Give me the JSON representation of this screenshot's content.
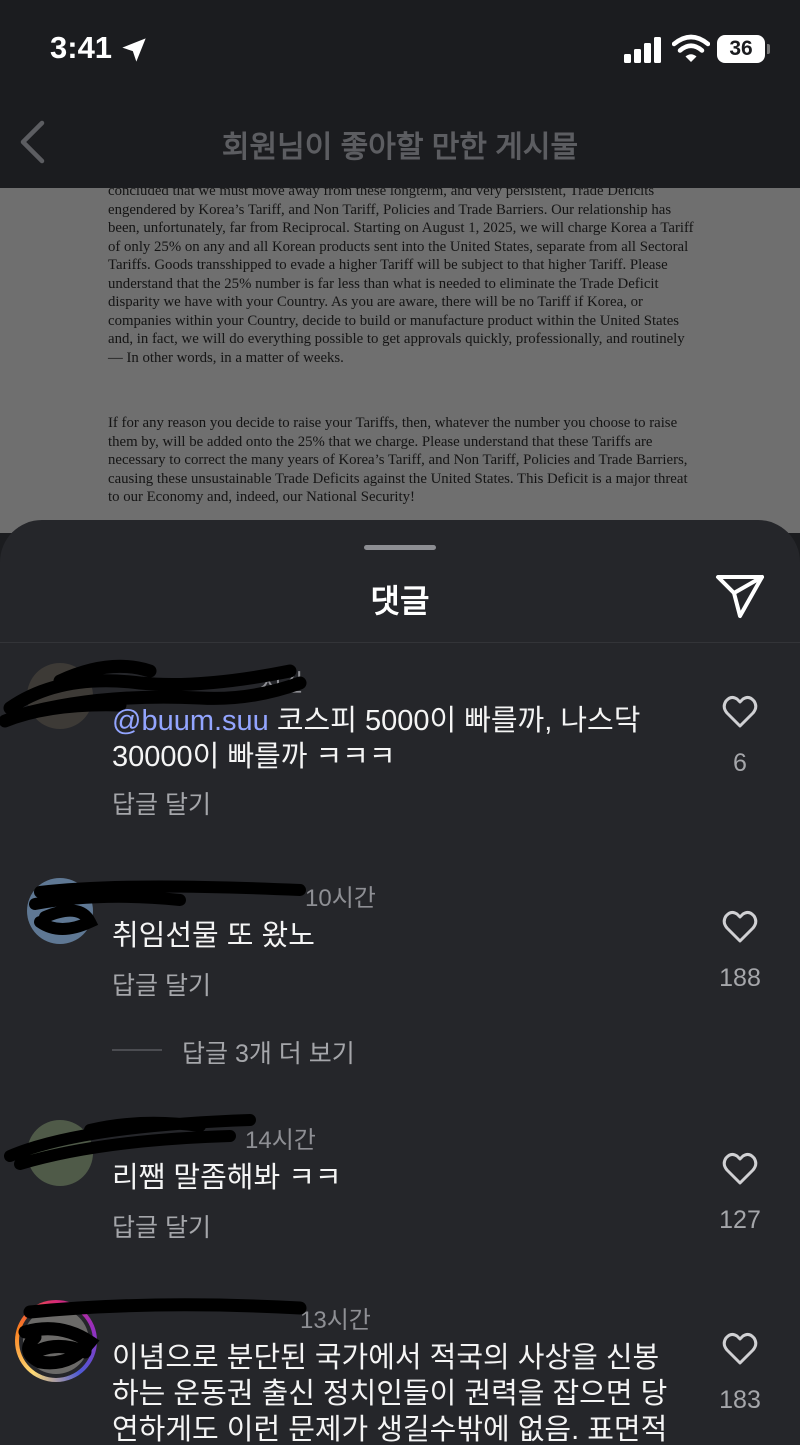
{
  "status_bar": {
    "time": "3:41",
    "battery": "36"
  },
  "header": {
    "title": "회원님이 좋아할 만한 게시물"
  },
  "document": {
    "paragraph1": "concluded that we must move away from these longterm, and very persistent, Trade Deficits engendered by Korea’s Tariff, and Non Tariff, Policies and Trade Barriers. Our relationship has been, unfortunately, far from Reciprocal. Starting on August 1, 2025, we will charge Korea a Tariff of only 25% on any and all Korean products sent into the United States, separate from all Sectoral Tariffs. Goods transshipped to evade a higher Tariff will be subject to that higher Tariff. Please understand that the 25% number is far less than what is needed to eliminate the Trade Deficit disparity we have with your Country. As you are aware, there will be no Tariff if Korea, or companies within your Country, decide to build or manufacture product within the United States and, in fact, we will do everything possible to get approvals quickly, professionally, and routinely — In other words, in a matter of weeks.",
    "paragraph2": "If for any reason you decide to raise your Tariffs, then, whatever the number you choose to raise them by, will be added onto the 25% that we charge. Please understand that these Tariffs are necessary to correct the many years of Korea’s Tariff, and Non Tariff, Policies and Trade Barriers, causing these unsustainable Trade Deficits against the United States. This Deficit is a major threat to our Economy and, indeed, our National Security!"
  },
  "comments_sheet": {
    "title": "댓글",
    "reply_label": "답글 달기",
    "comments": [
      {
        "user": "...",
        "time": "시간",
        "mention": "@buum.suu",
        "text": " 코스피 5000이 빠를까, 나스닥 30000이 빠를까 ㅋㅋㅋ",
        "likes": "6"
      },
      {
        "user": "...ight",
        "time": "10시간",
        "text": "취임선물 또 왔노",
        "likes": "188",
        "more_replies": "답글 3개 더 보기"
      },
      {
        "user": "...1",
        "time": "14시간",
        "text": "리쨈 말좀해봐  ㅋㅋ",
        "likes": "127"
      },
      {
        "user": "...",
        "time": "13시간",
        "text": "이념으로 분단된 국가에서 적국의 사상을 신봉하는 운동권 출신 정치인들이 권력을 잡으면 당연하게도 이런 문제가 생길수밖에 없음. 표면적으로",
        "likes": "183"
      }
    ]
  },
  "colors": {
    "background": "#1b1c1f",
    "sheet": "#25262a",
    "mention": "#93a5ff",
    "muted": "#a5a6aa"
  }
}
